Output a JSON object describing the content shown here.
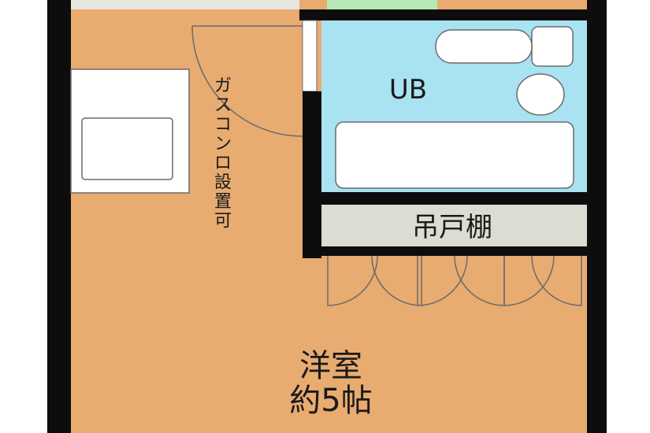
{
  "floorplan": {
    "labels": {
      "unit_bath": "UB",
      "storage": "吊戸棚",
      "gas_stove_note": [
        "ガ",
        "ス",
        "コ",
        "ン",
        "ロ",
        "設",
        "置",
        "可"
      ],
      "room_name": "洋室",
      "room_size": "約5帖"
    },
    "colors": {
      "floor": "#e8ab70",
      "wall": "#0d0d0d",
      "bath": "#a9e2f0",
      "storage": "#dcdcd2",
      "fixture": "#ffffff",
      "line": "#6b6b6b",
      "green_strip": "#b6e8b4"
    }
  }
}
